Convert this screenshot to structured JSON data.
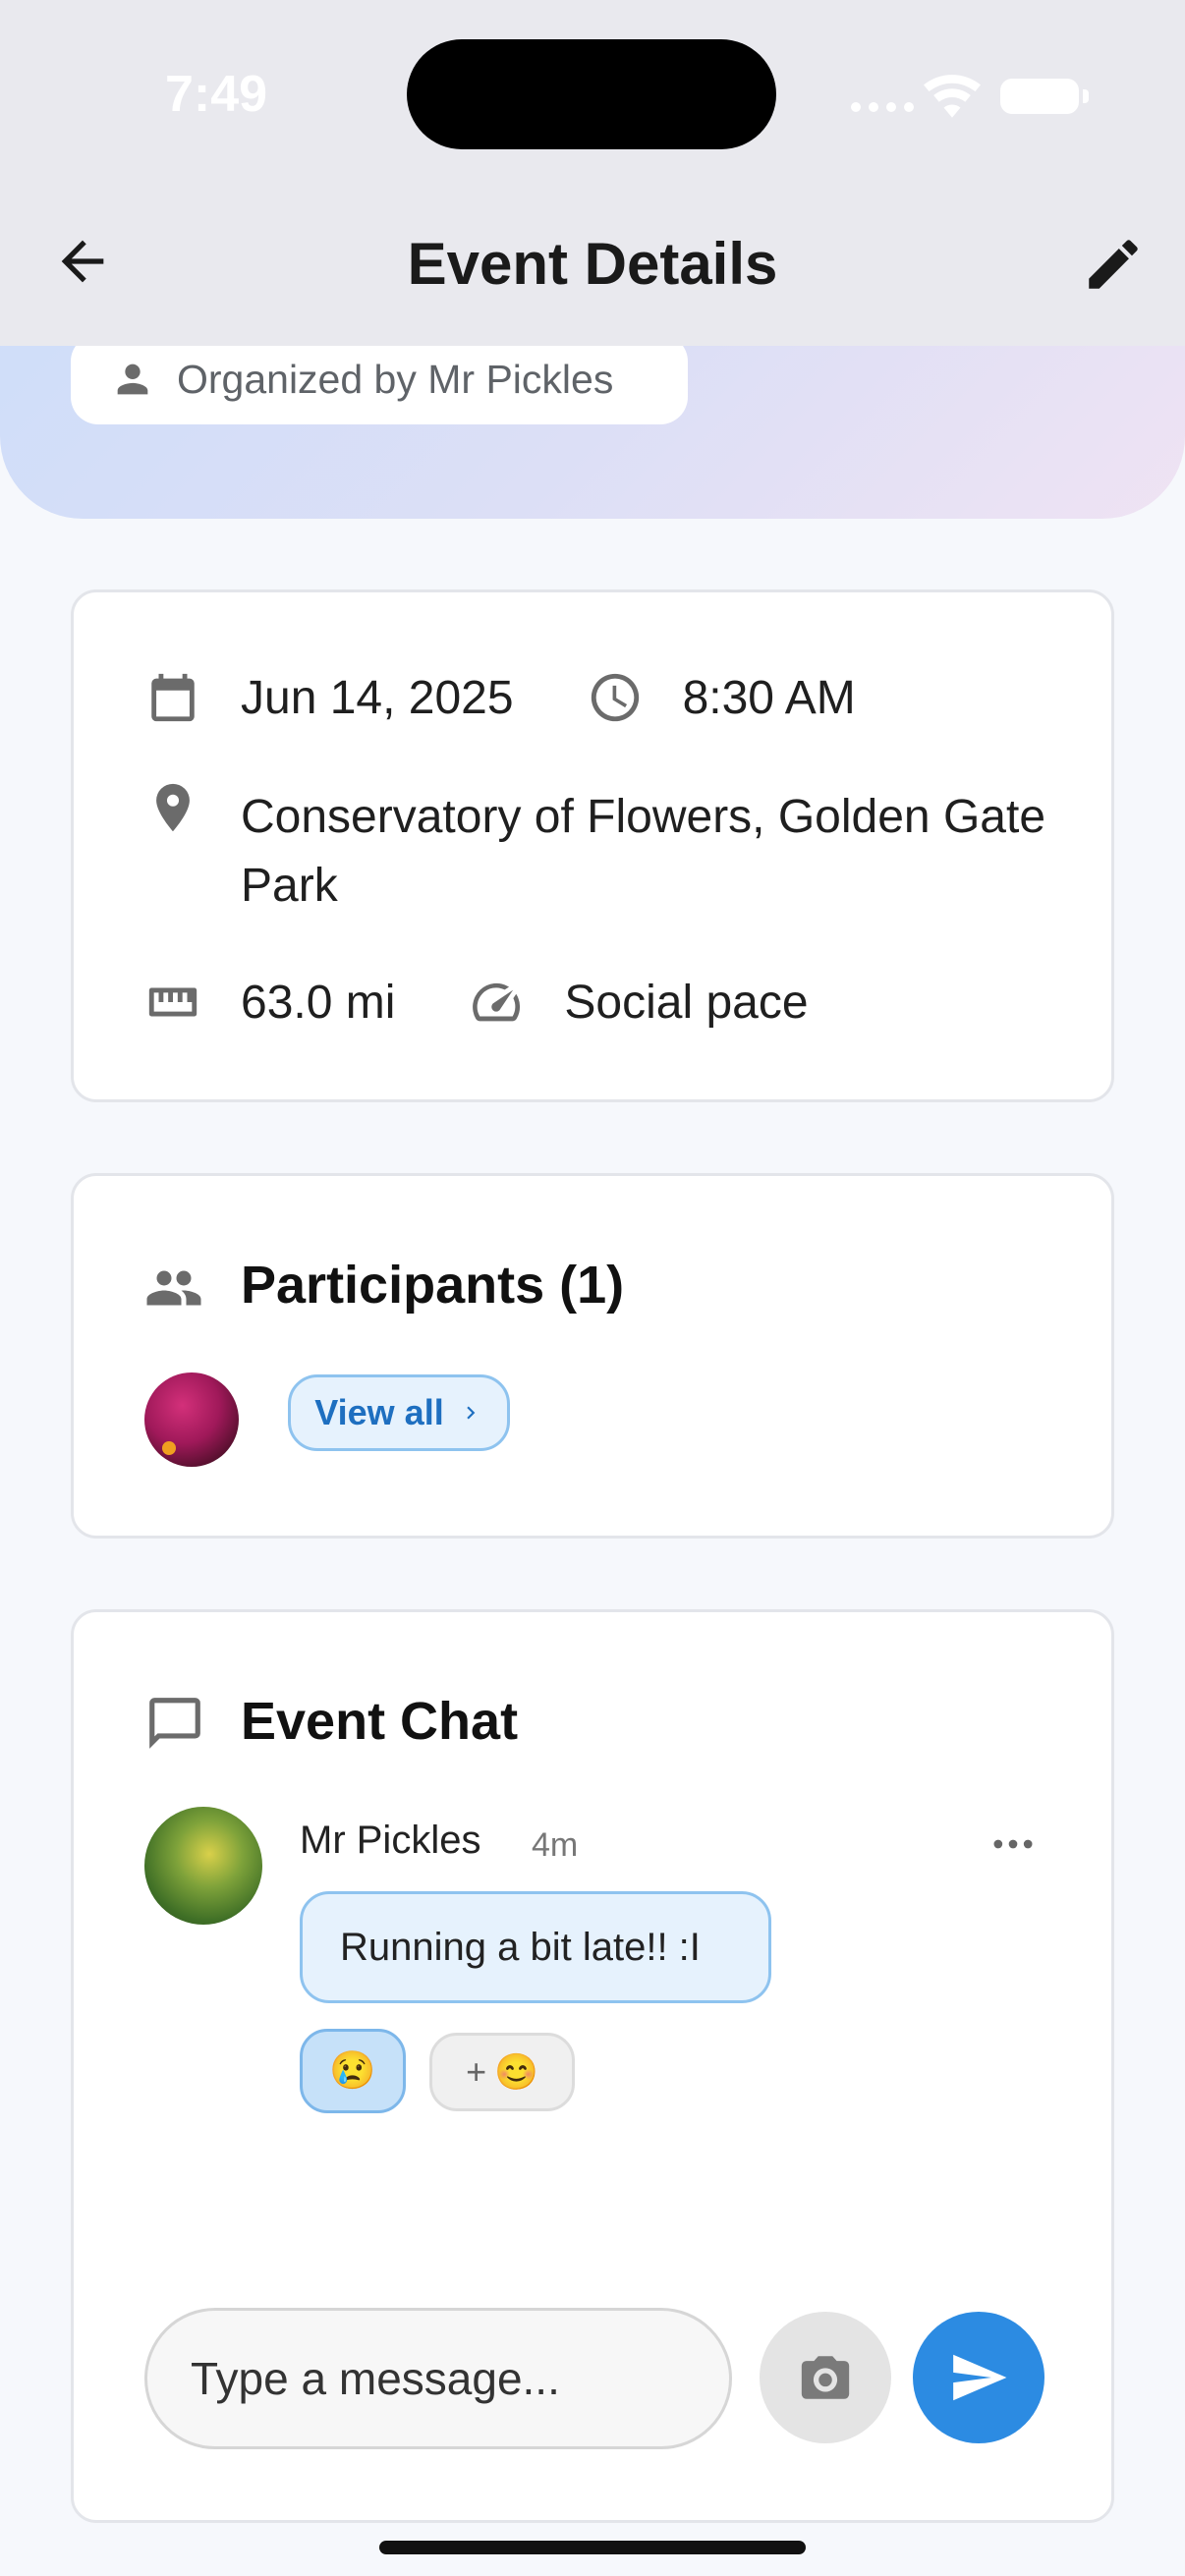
{
  "status_bar": {
    "time": "7:49"
  },
  "header": {
    "title": "Event Details"
  },
  "organizer": {
    "label": "Organized by Mr Pickles"
  },
  "details": {
    "date": "Jun 14, 2025",
    "time": "8:30 AM",
    "location": "Conservatory of Flowers, Golden Gate Park",
    "distance": "63.0 mi",
    "pace": "Social pace"
  },
  "participants": {
    "title": "Participants (1)",
    "view_all_label": "View all"
  },
  "chat": {
    "title": "Event Chat",
    "messages": [
      {
        "author": "Mr Pickles",
        "time_ago": "4m",
        "text": "Running a bit late!! :I",
        "reaction": "😢",
        "add_reaction_plus": "+",
        "add_reaction_emoji": "😊"
      }
    ],
    "input_placeholder": "Type a message..."
  },
  "colors": {
    "accent": "#2c8be2",
    "bubble_bg": "#e6f2fd",
    "bubble_border": "#8ec3ef"
  }
}
